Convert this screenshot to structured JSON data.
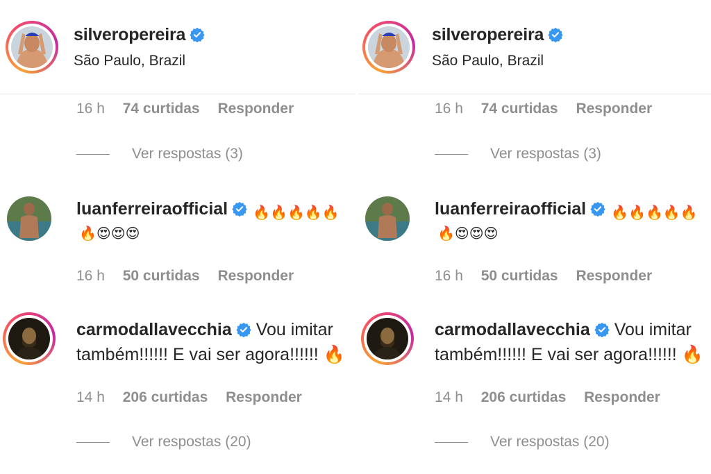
{
  "post_header": {
    "username": "silveropereira",
    "location": "São Paulo, Brazil"
  },
  "comments": [
    {
      "username": "",
      "time": "16 h",
      "likes": "74 curtidas",
      "reply_label": "Responder",
      "view_replies": "Ver respostas (3)"
    },
    {
      "username": "luanferreiraofficial",
      "text_emojis": "🔥🔥🔥🔥🔥",
      "line2_emojis": "🔥😍😍😍",
      "time": "16 h",
      "likes": "50 curtidas",
      "reply_label": "Responder"
    },
    {
      "username": "carmodallavecchia",
      "text_line1": "Vou imitar",
      "text_line2": "também!!!!!! E vai ser agora!!!!!! 🔥",
      "time": "14 h",
      "likes": "206 curtidas",
      "reply_label": "Responder",
      "view_replies": "Ver respostas (20)"
    }
  ],
  "icons": {
    "verified": "verified-badge-icon",
    "fire": "fire-icon",
    "smile": "heart-eyes-icon"
  },
  "colors": {
    "verified_blue": "#3897f0",
    "muted_text": "#8e8e8e",
    "ring_start": "#f9a234",
    "ring_end": "#c32aa3"
  }
}
